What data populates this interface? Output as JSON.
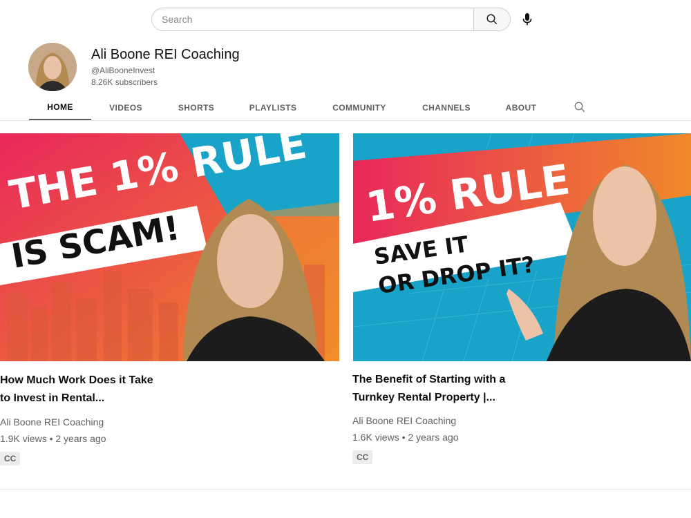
{
  "search": {
    "placeholder": "Search"
  },
  "channel": {
    "name": "Ali Boone REI Coaching",
    "handle": "@AliBooneInvest",
    "subscribers": "8.26K subscribers"
  },
  "tabs": [
    {
      "label": "HOME",
      "active": true
    },
    {
      "label": "VIDEOS"
    },
    {
      "label": "SHORTS"
    },
    {
      "label": "PLAYLISTS"
    },
    {
      "label": "COMMUNITY"
    },
    {
      "label": "CHANNELS"
    },
    {
      "label": "ABOUT"
    }
  ],
  "videos": [
    {
      "thumb_text_top": "THE 1% RULE",
      "thumb_text_bottom": "IS SCAM!",
      "title_line1": "How Much Work Does it Take",
      "title_line2": "to Invest in Rental...",
      "channel": "Ali Boone REI Coaching",
      "stats": "1.9K views • 2 years ago",
      "badge": "CC"
    },
    {
      "thumb_text_top": "1% RULE",
      "thumb_text_mid": "SAVE IT",
      "thumb_text_bottom": "OR DROP IT?",
      "title_line1": "The Benefit of Starting with a",
      "title_line2": "Turnkey Rental Property |...",
      "channel": "Ali Boone REI Coaching",
      "stats": "1.6K views • 2 years ago",
      "badge": "CC"
    }
  ],
  "colors": {
    "accent_pink": "#e8285a",
    "accent_orange": "#f08a2a",
    "accent_blue": "#1aa3c8"
  },
  "icons": [
    "search-icon",
    "microphone-icon",
    "tab-search-icon"
  ]
}
